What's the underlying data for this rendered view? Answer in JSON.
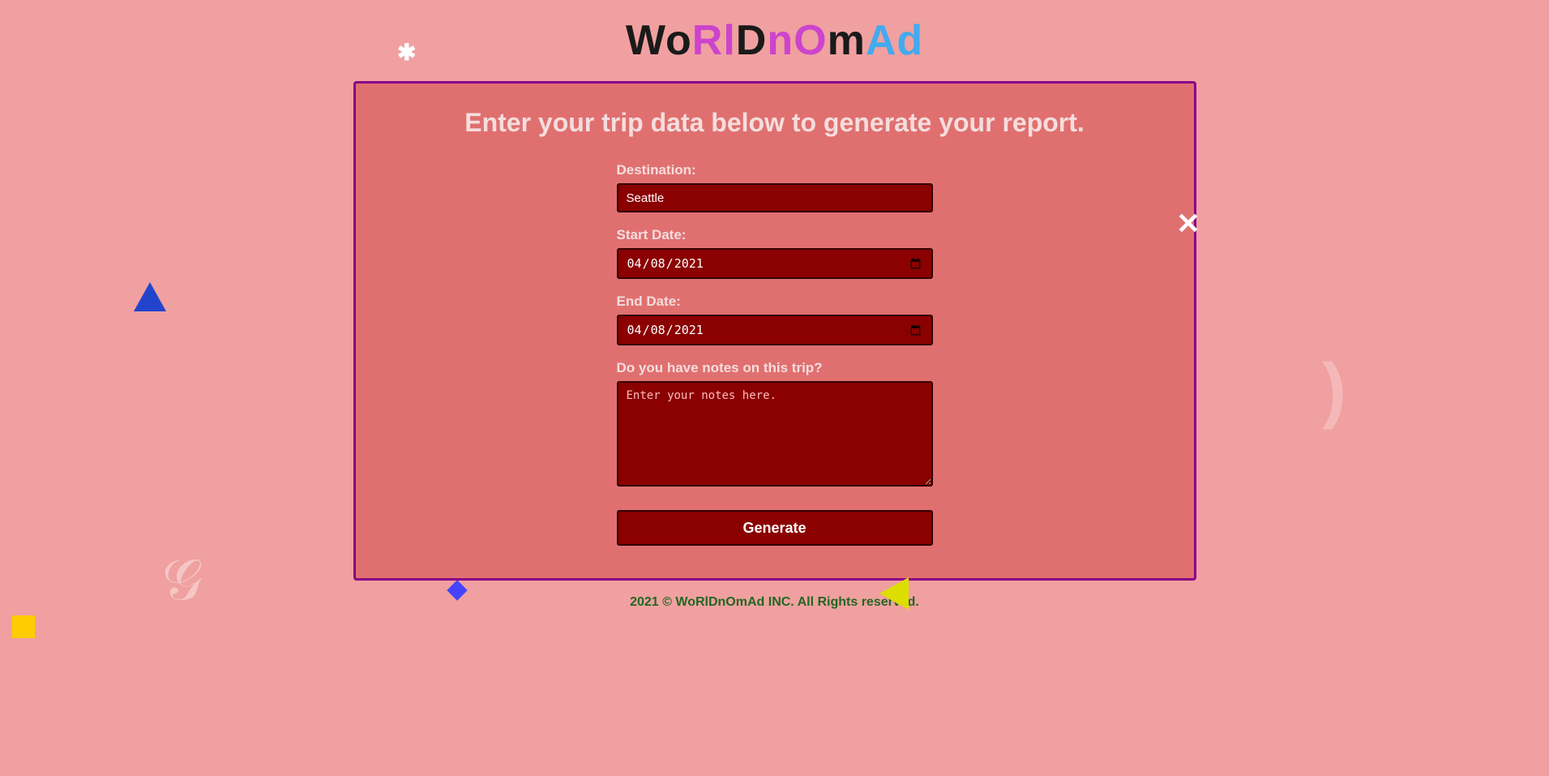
{
  "header": {
    "logo": {
      "letters": [
        {
          "char": "W",
          "class": "logo-W"
        },
        {
          "char": "o",
          "class": "logo-o"
        },
        {
          "char": "R",
          "class": "logo-R"
        },
        {
          "char": "l",
          "class": "logo-l"
        },
        {
          "char": "D",
          "class": "logo-D"
        },
        {
          "char": "n",
          "class": "logo-n"
        },
        {
          "char": "O",
          "class": "logo-O"
        },
        {
          "char": "m",
          "class": "logo-m"
        },
        {
          "char": "A",
          "class": "logo-A"
        },
        {
          "char": "d",
          "class": "logo-d"
        }
      ],
      "full": "WoRlDnOmAd"
    }
  },
  "form": {
    "intro": "Enter your trip data below to generate your report.",
    "destination_label": "Destination:",
    "destination_value": "Seattle",
    "start_date_label": "Start Date:",
    "start_date_value": "2021-04-08",
    "end_date_label": "End Date:",
    "end_date_value": "2021-04-08",
    "notes_label": "Do you have notes on this trip?",
    "notes_placeholder": "Enter your notes here.",
    "generate_btn": "Generate"
  },
  "footer": {
    "text": "2021 © WoRlDnOmAd INC. All Rights reserved."
  },
  "decorations": {
    "asterisk": "*",
    "x_mark": "✕",
    "spiral": "𝒢"
  }
}
